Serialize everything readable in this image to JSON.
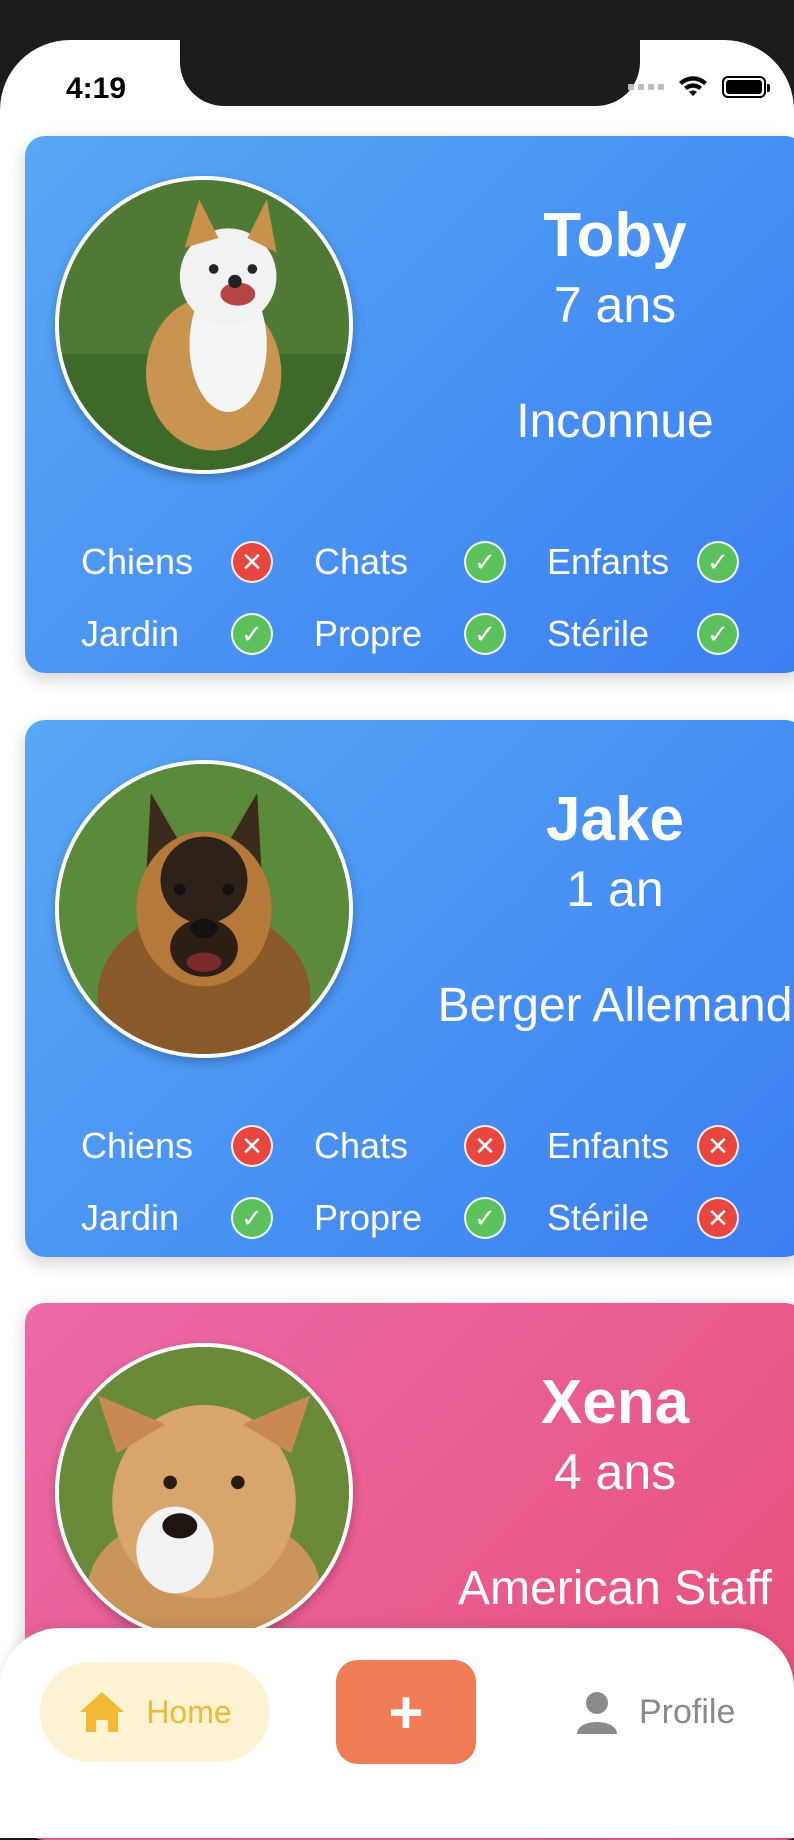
{
  "status_bar": {
    "time": "4:19"
  },
  "pets": [
    {
      "name": "Toby",
      "age": "7 ans",
      "breed": "Inconnue",
      "theme": "blue",
      "traits": [
        {
          "label": "Chiens",
          "ok": false
        },
        {
          "label": "Chats",
          "ok": true
        },
        {
          "label": "Enfants",
          "ok": true
        },
        {
          "label": "Jardin",
          "ok": true
        },
        {
          "label": "Propre",
          "ok": true
        },
        {
          "label": "Stérile",
          "ok": true
        }
      ]
    },
    {
      "name": "Jake",
      "age": "1 an",
      "breed": "Berger Allemand",
      "theme": "blue",
      "traits": [
        {
          "label": "Chiens",
          "ok": false
        },
        {
          "label": "Chats",
          "ok": false
        },
        {
          "label": "Enfants",
          "ok": false
        },
        {
          "label": "Jardin",
          "ok": true
        },
        {
          "label": "Propre",
          "ok": true
        },
        {
          "label": "Stérile",
          "ok": false
        }
      ]
    },
    {
      "name": "Xena",
      "age": "4 ans",
      "breed": "American Staff",
      "theme": "pink",
      "traits": []
    }
  ],
  "nav": {
    "home_label": "Home",
    "add_label": "+",
    "profile_label": "Profile"
  },
  "colors": {
    "card_blue": "#3b7ef2",
    "card_pink": "#e64f77",
    "yes": "#5cc15c",
    "no": "#e8473f",
    "home_accent": "#f2b935",
    "add_button": "#ef7c55"
  },
  "icons": {
    "yes": "check-icon",
    "no": "cross-icon",
    "home": "home-icon",
    "profile": "user-icon"
  }
}
